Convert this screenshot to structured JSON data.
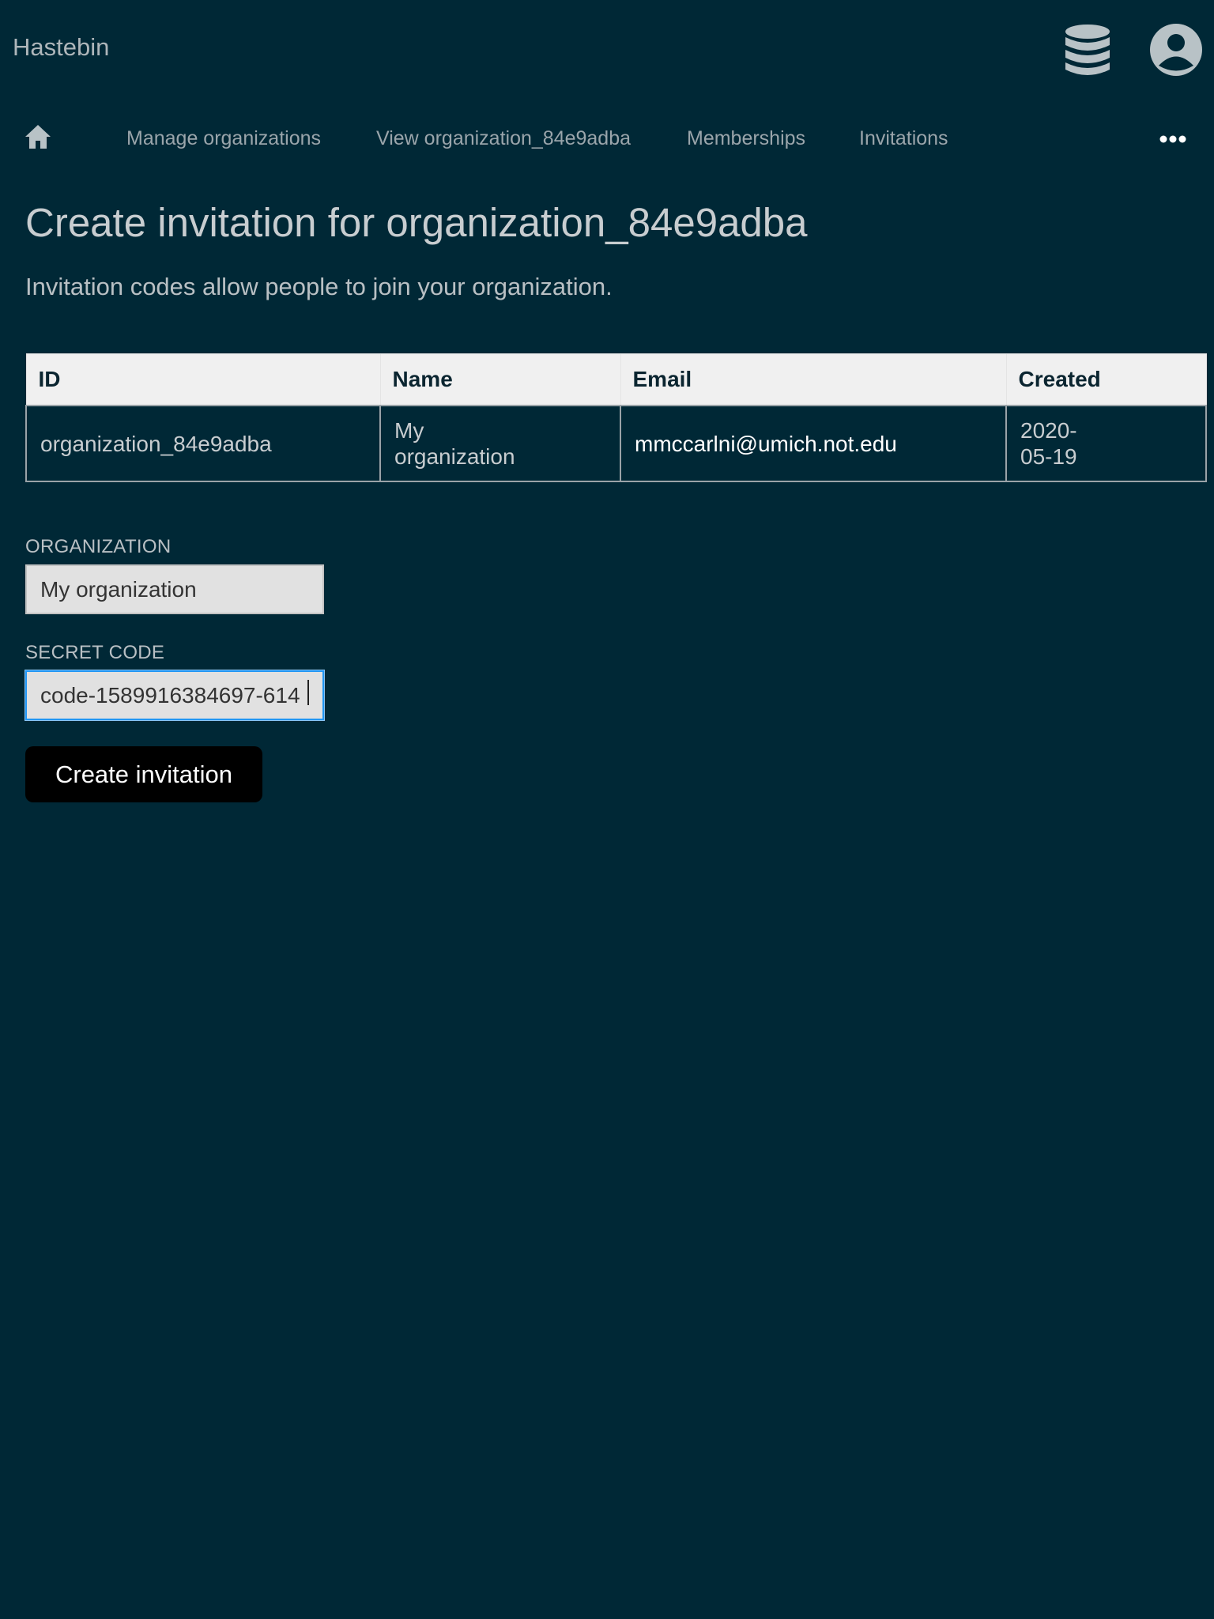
{
  "app": {
    "brand": "Hastebin"
  },
  "icons": {
    "database": "database-icon",
    "account": "account-icon",
    "home": "home-icon",
    "more": "more-horizontal-icon"
  },
  "nav": {
    "links": [
      "Manage organizations",
      "View organization_84e9adba",
      "Memberships",
      "Invitations"
    ]
  },
  "page": {
    "title": "Create invitation for organization_84e9adba",
    "subtitle": "Invitation codes allow people to join your organization."
  },
  "table": {
    "headers": [
      "ID",
      "Name",
      "Email",
      "Created"
    ],
    "row": {
      "id": "organization_84e9adba",
      "name_line1": "My",
      "name_line2": "organization",
      "email": "mmccarlni@umich.not.edu",
      "created_line1": "2020-",
      "created_line2": "05-19"
    }
  },
  "form": {
    "organization_label": "ORGANIZATION",
    "organization_value": "My organization",
    "secret_label": "SECRET CODE",
    "secret_value": "code-1589916384697-614",
    "submit_label": "Create invitation"
  },
  "colors": {
    "background": "#002836",
    "text": "#c8cdd0",
    "button": "#000000",
    "focus": "#2196f3"
  }
}
